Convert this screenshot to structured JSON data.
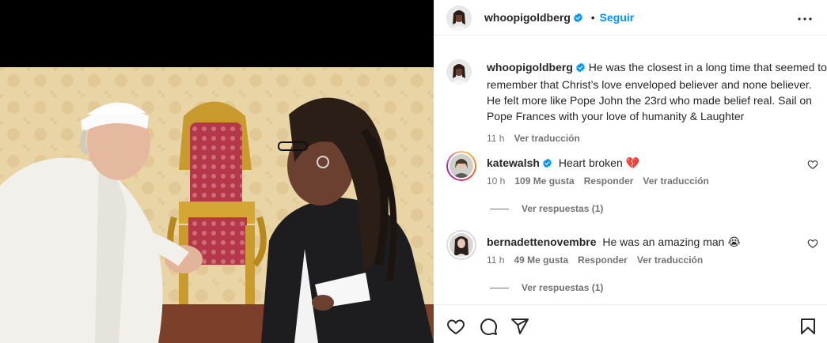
{
  "post": {
    "author": "whoopigoldberg",
    "follow_label": "Seguir",
    "caption": "He was the closest in a long time that seemed to remember that Christ’s love enveloped believer and none believer. He felt more like Pope John the 23rd who made belief real. Sail on Pope Frances with your love of humanity & Laughter",
    "caption_time": "11 h",
    "see_translation": "Ver traducción"
  },
  "comments": [
    {
      "user": "katewalsh",
      "verified": true,
      "text": "Heart broken",
      "emoji": "💔",
      "time": "10 h",
      "likes": "109 Me gusta",
      "reply": "Responder",
      "translate": "Ver traducción",
      "view_replies": "Ver respuestas (1)"
    },
    {
      "user": "bernadettenovembre",
      "verified": false,
      "text": "He was an amazing man",
      "emoji": "😭",
      "time": "11 h",
      "likes": "49 Me gusta",
      "reply": "Responder",
      "translate": "Ver traducción",
      "view_replies": "Ver respuestas (1)"
    }
  ],
  "icons": {
    "like": "heart-icon",
    "comment": "comment-icon",
    "share": "share-icon",
    "save": "bookmark-icon",
    "more": "more-options-icon",
    "verified": "verified-badge-icon"
  },
  "colors": {
    "accent": "#0095f6",
    "verified": "#0095f6",
    "secondary_text": "#737373"
  }
}
